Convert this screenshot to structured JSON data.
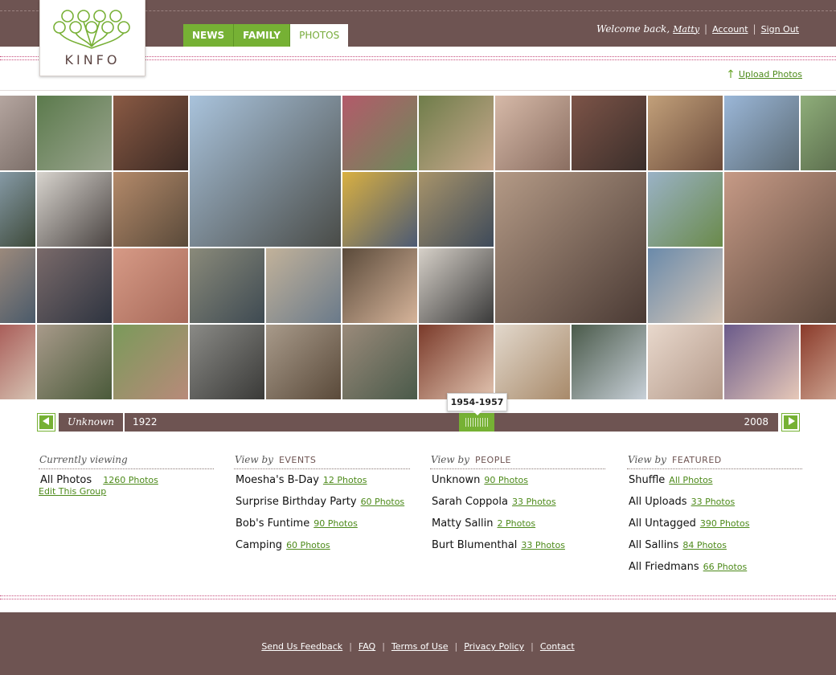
{
  "brand": {
    "name": "KINFO"
  },
  "nav": {
    "tabs": [
      {
        "label": "NEWS",
        "active": false
      },
      {
        "label": "FAMILY",
        "active": false
      },
      {
        "label": "PHOTOS",
        "active": true
      }
    ]
  },
  "user_bar": {
    "welcome_prefix": "Welcome back,",
    "username": "Matty",
    "account_label": "Account",
    "sign_out_label": "Sign Out"
  },
  "upload": {
    "label": "Upload Photos",
    "icon": "upload-arrow-icon"
  },
  "timeline": {
    "unknown_label": "Unknown",
    "start_year": "1922",
    "end_year": "2008",
    "selected_range": "1954-1957",
    "prev_icon": "triangle-left-icon",
    "next_icon": "triangle-right-icon"
  },
  "current": {
    "heading": "Currently viewing",
    "group": "All Photos",
    "count": "1260 Photos",
    "edit_label": "Edit This Group"
  },
  "events": {
    "prefix": "View by",
    "heading": "EVENTS",
    "items": [
      {
        "name": "Moesha's B-Day",
        "count": "12 Photos"
      },
      {
        "name": "Surprise Birthday Party",
        "count": "60 Photos"
      },
      {
        "name": "Bob's Funtime",
        "count": "90 Photos"
      },
      {
        "name": "Camping",
        "count": "60 Photos"
      }
    ]
  },
  "people": {
    "prefix": "View by",
    "heading": "PEOPLE",
    "items": [
      {
        "name": "Unknown",
        "count": "90 Photos"
      },
      {
        "name": "Sarah Coppola",
        "count": "33 Photos"
      },
      {
        "name": "Matty Sallin",
        "count": "2 Photos"
      },
      {
        "name": "Burt Blumenthal",
        "count": "33 Photos"
      }
    ]
  },
  "featured": {
    "prefix": "View by",
    "heading": "FEATURED",
    "items": [
      {
        "name": "Shuffle",
        "count": "All Photos"
      },
      {
        "name": "All Uploads",
        "count": "33 Photos"
      },
      {
        "name": "All Untagged",
        "count": "390 Photos"
      },
      {
        "name": "All Sallins",
        "count": "84 Photos"
      },
      {
        "name": "All Friedmans",
        "count": "66 Photos"
      }
    ]
  },
  "footer": {
    "links": [
      "Send Us Feedback",
      "FAQ",
      "Terms of Use",
      "Privacy Policy",
      "Contact"
    ]
  },
  "colors": {
    "brown": "#6e5452",
    "green": "#76b134",
    "link_green": "#4d8a1a",
    "pink_dots": "#c64e7c"
  }
}
